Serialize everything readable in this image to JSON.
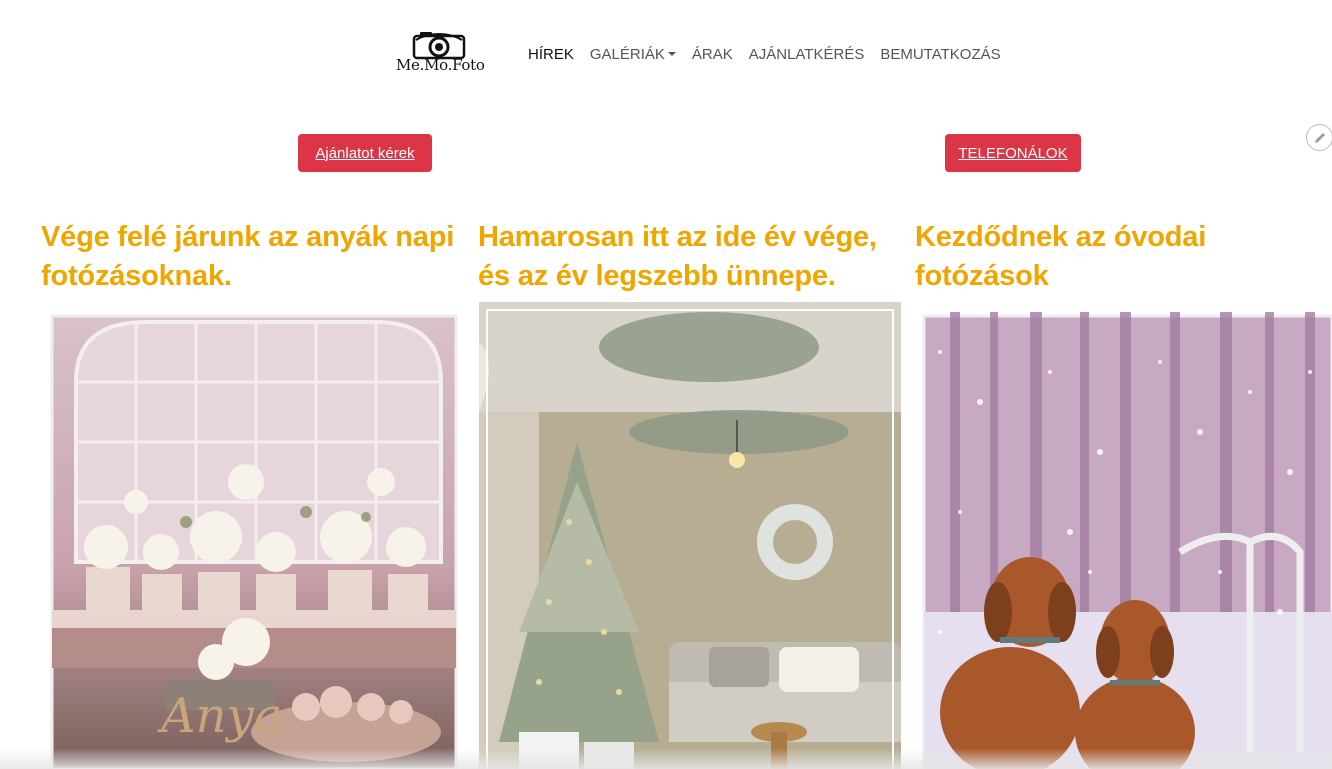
{
  "header": {
    "logo_text": "Me.Mo.Foto",
    "nav": [
      {
        "label": "HÍREK",
        "active": true
      },
      {
        "label": "GALÉRIÁK",
        "dropdown": true
      },
      {
        "label": "ÁRAK"
      },
      {
        "label": "AJÁNLATKÉRÉS"
      },
      {
        "label": "BEMUTATKOZÁS"
      }
    ]
  },
  "actions": {
    "offer_button": "Ajánlatot kérek",
    "call_button": "TELEFONÁLOK"
  },
  "posts": [
    {
      "title": "Vége felé járunk az anyák napi fotózásoknak.",
      "image_text": "Anya"
    },
    {
      "title": "Hamarosan itt az ide év vége, és az év legszebb ünnepe."
    },
    {
      "title": "Kezdődnek az óvodai fotózások"
    }
  ],
  "colors": {
    "accent": "#f0a500",
    "button": "#dc3545"
  }
}
